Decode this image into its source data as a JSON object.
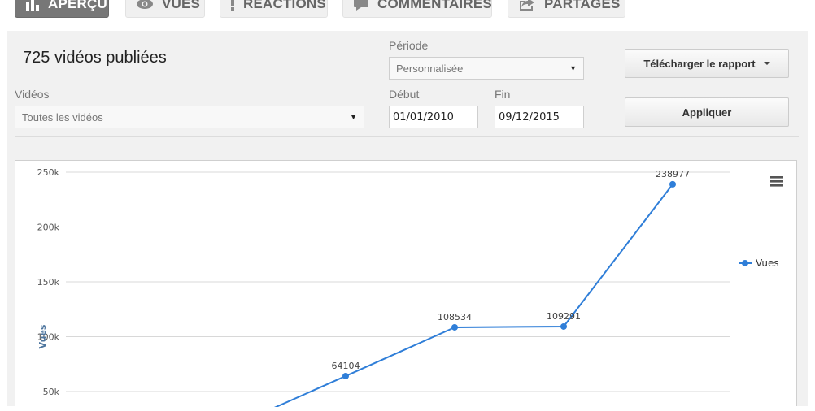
{
  "tabs": [
    {
      "label": "APERÇU",
      "icon": "bar-chart-icon",
      "active": true
    },
    {
      "label": "VUES",
      "icon": "eye-icon",
      "active": false
    },
    {
      "label": "RÉACTIONS",
      "icon": "exclamation-icon",
      "active": false
    },
    {
      "label": "COMMENTAIRES",
      "icon": "comment-icon",
      "active": false
    },
    {
      "label": "PARTAGES",
      "icon": "share-icon",
      "active": false
    }
  ],
  "header": {
    "title": "725 vidéos publiées"
  },
  "filters": {
    "periode_label": "Période",
    "periode_value": "Personnalisée",
    "videos_label": "Vidéos",
    "videos_value": "Toutes les vidéos",
    "debut_label": "Début",
    "debut_value": "01/01/2010",
    "fin_label": "Fin",
    "fin_value": "09/12/2015"
  },
  "buttons": {
    "download_label": "Télécharger le rapport",
    "apply_label": "Appliquer"
  },
  "chart_data": {
    "type": "line",
    "ylabel": "Vues",
    "yticks": [
      "250k",
      "200k",
      "150k",
      "100k",
      "50k"
    ],
    "ylim": [
      0,
      250000
    ],
    "grid": true,
    "legend_position": "right",
    "series": [
      {
        "name": "Vues",
        "color": "#2f7ed8",
        "points": [
          {
            "value": 20000,
            "label": ""
          },
          {
            "value": 64104,
            "label": "64104"
          },
          {
            "value": 108534,
            "label": "108534"
          },
          {
            "value": 109291,
            "label": "109291"
          },
          {
            "value": 238977,
            "label": "238977"
          }
        ]
      }
    ]
  }
}
